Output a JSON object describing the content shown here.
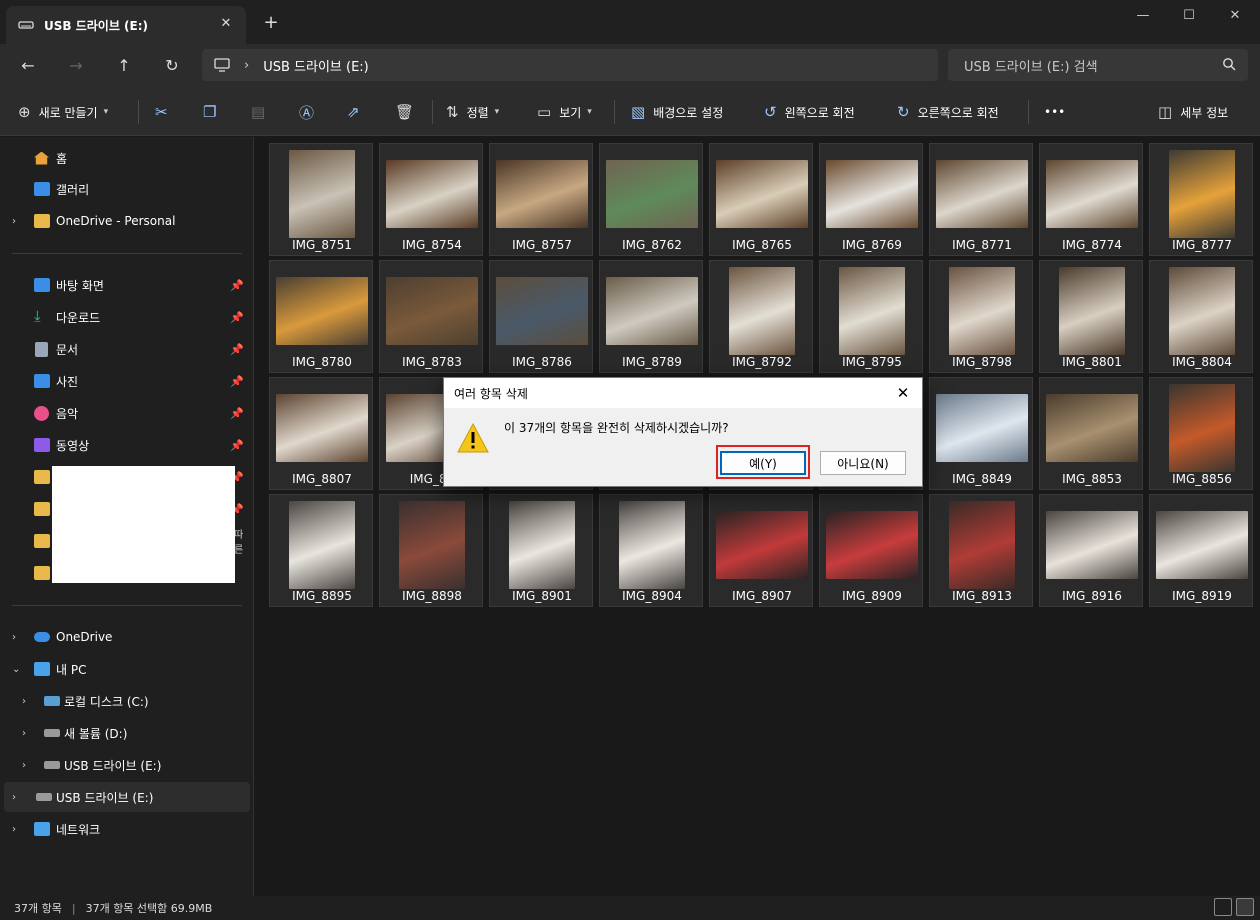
{
  "window": {
    "tab_title": "USB 드라이브 (E:)",
    "tab_close": "✕",
    "new_tab": "+",
    "controls": [
      "—",
      "☐",
      "✕"
    ]
  },
  "nav": {
    "back": "←",
    "forward": "→",
    "up": "↑",
    "refresh": "↻",
    "address_sep": "›",
    "address": "USB 드라이브 (E:)",
    "search_placeholder": "USB 드라이브 (E:) 검색",
    "search_icon": "⌕"
  },
  "toolbar": {
    "new_label": "새로 만들기",
    "sort_label": "정렬",
    "view_label": "보기",
    "set_bg_label": "배경으로 설정",
    "rotate_left_label": "왼쪽으로 회전",
    "rotate_right_label": "오른쪽으로 회전",
    "more_label": "•••",
    "details_label": "세부 정보"
  },
  "sidebar": {
    "home": "홈",
    "gallery": "갤러리",
    "onedrive_personal": "OneDrive - Personal",
    "quick": [
      {
        "label": "바탕 화면",
        "color": "#3a8ee6"
      },
      {
        "label": "다운로드",
        "color": "#2ecc71"
      },
      {
        "label": "문서",
        "color": "#9aa7b8"
      },
      {
        "label": "사진",
        "color": "#3a8ee6"
      },
      {
        "label": "음악",
        "color": "#e8508a"
      },
      {
        "label": "동영상",
        "color": "#8e5be8"
      }
    ],
    "partial_text": "따른",
    "onedrive": "OneDrive",
    "this_pc": "내 PC",
    "drive_c": "로컬 디스크 (C:)",
    "drive_d": "새 볼륨 (D:)",
    "drive_e": "USB 드라이브 (E:)",
    "drive_e_root": "USB 드라이브 (E:)",
    "network": "네트워크"
  },
  "files": [
    {
      "name": "IMG_8751",
      "bg": "#6b5843",
      "pic": "#c9c2b6",
      "portrait": true
    },
    {
      "name": "IMG_8754",
      "bg": "#5a3a24",
      "pic": "#d8d2c4",
      "portrait": false
    },
    {
      "name": "IMG_8757",
      "bg": "#4a3626",
      "pic": "#c7a882",
      "portrait": false
    },
    {
      "name": "IMG_8762",
      "bg": "#6f6452",
      "pic": "#5f8a5a",
      "portrait": false
    },
    {
      "name": "IMG_8765",
      "bg": "#5c3f28",
      "pic": "#d9cdb8",
      "portrait": false
    },
    {
      "name": "IMG_8769",
      "bg": "#6a4a2e",
      "pic": "#e5e3de",
      "portrait": false
    },
    {
      "name": "IMG_8771",
      "bg": "#5e4630",
      "pic": "#dcd6cb",
      "portrait": false
    },
    {
      "name": "IMG_8774",
      "bg": "#5e4630",
      "pic": "#e0dad0",
      "portrait": false
    },
    {
      "name": "IMG_8777",
      "bg": "#3e3a33",
      "pic": "#e6a23a",
      "portrait": true
    },
    {
      "name": "IMG_8780",
      "bg": "#4a3f33",
      "pic": "#d99a3c",
      "portrait": false
    },
    {
      "name": "IMG_8783",
      "bg": "#4e3f30",
      "pic": "#7a5a3a",
      "portrait": false
    },
    {
      "name": "IMG_8786",
      "bg": "#5b4d3c",
      "pic": "#4a5a6a",
      "portrait": false
    },
    {
      "name": "IMG_8789",
      "bg": "#6a5c48",
      "pic": "#cfcac0",
      "portrait": false
    },
    {
      "name": "IMG_8792",
      "bg": "#6c5540",
      "pic": "#e4dfd5",
      "portrait": true
    },
    {
      "name": "IMG_8795",
      "bg": "#6a5642",
      "pic": "#e2ddd2",
      "portrait": true
    },
    {
      "name": "IMG_8798",
      "bg": "#6a5240",
      "pic": "#e0d8cc",
      "portrait": true
    },
    {
      "name": "IMG_8801",
      "bg": "#4a3a2c",
      "pic": "#d8cfc0",
      "portrait": true
    },
    {
      "name": "IMG_8804",
      "bg": "#5e4a38",
      "pic": "#dcd3c6",
      "portrait": true
    },
    {
      "name": "IMG_8807",
      "bg": "#5c4330",
      "pic": "#e0d8cc",
      "portrait": false
    },
    {
      "name": "IMG_88",
      "bg": "#5a4230",
      "pic": "#dad2c6",
      "portrait": false
    },
    {
      "name": "",
      "bg": "#2a2a2a",
      "pic": "#2a2a2a",
      "portrait": false
    },
    {
      "name": "",
      "bg": "#2a2a2a",
      "pic": "#2a2a2a",
      "portrait": false
    },
    {
      "name": "",
      "bg": "#2a2a2a",
      "pic": "#2a2a2a",
      "portrait": false
    },
    {
      "name": "IMG_8846",
      "bg": "#3a4a5a",
      "pic": "#6f8aa6",
      "portrait": true
    },
    {
      "name": "IMG_8849",
      "bg": "#6a7a8a",
      "pic": "#dfe6ee",
      "portrait": false
    },
    {
      "name": "IMG_8853",
      "bg": "#4a3c2c",
      "pic": "#a89070",
      "portrait": false
    },
    {
      "name": "IMG_8856",
      "bg": "#3a3530",
      "pic": "#c45a2a",
      "portrait": true
    },
    {
      "name": "IMG_8895",
      "bg": "#4a4540",
      "pic": "#e8e4de",
      "portrait": true
    },
    {
      "name": "IMG_8898",
      "bg": "#3a3030",
      "pic": "#8a4a3a",
      "portrait": true
    },
    {
      "name": "IMG_8901",
      "bg": "#4a4540",
      "pic": "#ebe6e0",
      "portrait": true
    },
    {
      "name": "IMG_8904",
      "bg": "#484440",
      "pic": "#ece7e1",
      "portrait": true
    },
    {
      "name": "IMG_8907",
      "bg": "#2a2424",
      "pic": "#c23a3a",
      "portrait": false
    },
    {
      "name": "IMG_8909",
      "bg": "#2a2424",
      "pic": "#c83c3c",
      "portrait": false
    },
    {
      "name": "IMG_8913",
      "bg": "#3a2a26",
      "pic": "#b03c36",
      "portrait": true
    },
    {
      "name": "IMG_8916",
      "bg": "#4a4540",
      "pic": "#e8e2db",
      "portrait": false
    },
    {
      "name": "IMG_8919",
      "bg": "#4a4540",
      "pic": "#eae5df",
      "portrait": false
    }
  ],
  "status": {
    "count": "37개 항목",
    "divider": "|",
    "selected": "37개 항목 선택함 69.9MB"
  },
  "dialog": {
    "title": "여러 항목 삭제",
    "close": "✕",
    "message": "이 37개의 항목을 완전히 삭제하시겠습니까?",
    "yes": "예(Y)",
    "no": "아니요(N)"
  }
}
